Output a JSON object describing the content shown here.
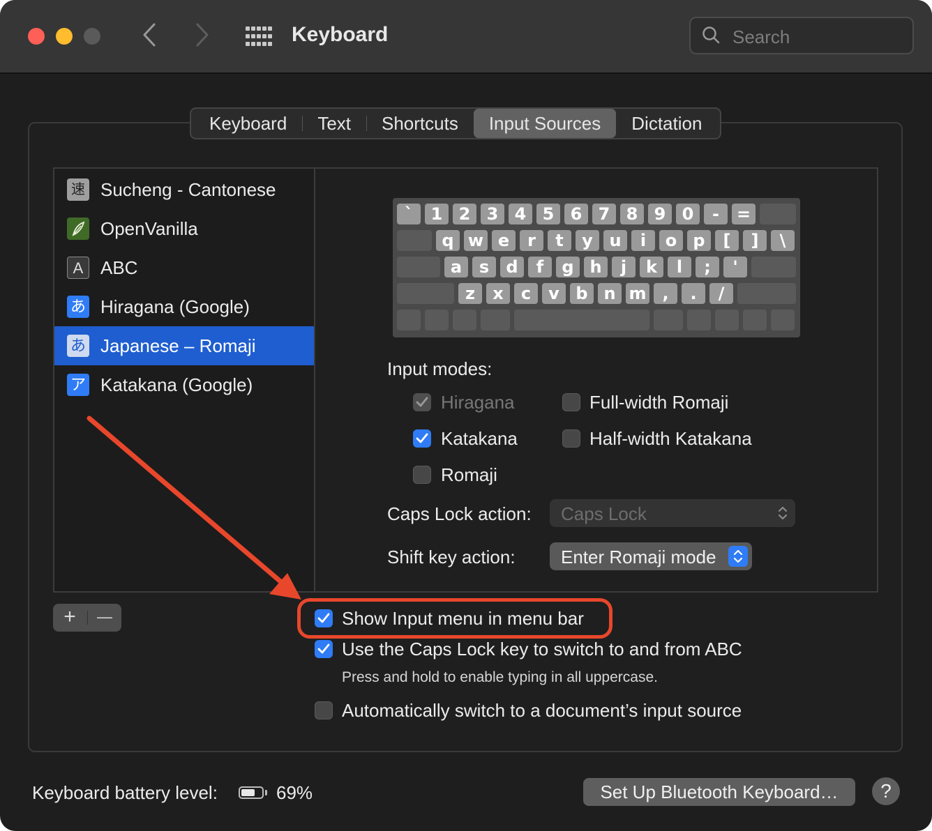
{
  "window": {
    "title": "Keyboard"
  },
  "search": {
    "placeholder": "Search"
  },
  "tabs": [
    "Keyboard",
    "Text",
    "Shortcuts",
    "Input Sources",
    "Dictation"
  ],
  "active_tab": "Input Sources",
  "sources": [
    {
      "label": "Sucheng - Cantonese",
      "icon": "速",
      "selected": false
    },
    {
      "label": "OpenVanilla",
      "icon": "leaf",
      "selected": false
    },
    {
      "label": "ABC",
      "icon": "A",
      "selected": false
    },
    {
      "label": "Hiragana (Google)",
      "icon": "あ",
      "selected": false
    },
    {
      "label": "Japanese – Romaji",
      "icon": "あ",
      "selected": true
    },
    {
      "label": "Katakana (Google)",
      "icon": "ア",
      "selected": false
    }
  ],
  "keyboard_rows": [
    [
      "`",
      "1",
      "2",
      "3",
      "4",
      "5",
      "6",
      "7",
      "8",
      "9",
      "0",
      "-",
      "="
    ],
    [
      "q",
      "w",
      "e",
      "r",
      "t",
      "y",
      "u",
      "i",
      "o",
      "p",
      "[",
      "]",
      "\\"
    ],
    [
      "a",
      "s",
      "d",
      "f",
      "g",
      "h",
      "j",
      "k",
      "l",
      ";",
      "'"
    ],
    [
      "z",
      "x",
      "c",
      "v",
      "b",
      "n",
      "m",
      ",",
      ".",
      "/"
    ]
  ],
  "input_modes": {
    "heading": "Input modes:",
    "hiragana": {
      "label": "Hiragana",
      "checked": true,
      "enabled": false
    },
    "katakana": {
      "label": "Katakana",
      "checked": true
    },
    "romaji": {
      "label": "Romaji",
      "checked": false
    },
    "full_width_romaji": {
      "label": "Full-width Romaji",
      "checked": false
    },
    "half_width_katakana": {
      "label": "Half-width Katakana",
      "checked": false
    }
  },
  "caps_lock_action": {
    "label": "Caps Lock action:",
    "value": "Caps Lock"
  },
  "shift_key_action": {
    "label": "Shift key action:",
    "value": "Enter Romaji mode"
  },
  "list_controls": {
    "add": "+",
    "remove": "—"
  },
  "options": {
    "show_input_menu": {
      "label": "Show Input menu in menu bar",
      "checked": true
    },
    "caps_lock_switch": {
      "label": "Use the Caps Lock key to switch to and from ABC",
      "checked": true,
      "help": "Press and hold to enable typing in all uppercase."
    },
    "auto_switch": {
      "label": "Automatically switch to a document’s input source",
      "checked": false
    }
  },
  "battery": {
    "label": "Keyboard battery level:",
    "percent_text": "69%",
    "level": 0.69
  },
  "bluetooth_button": "Set Up Bluetooth Keyboard…",
  "help_button": "?",
  "colors": {
    "accent": "#2f7cf6",
    "selection": "#1f5ed0",
    "highlight": "#e8472c"
  }
}
